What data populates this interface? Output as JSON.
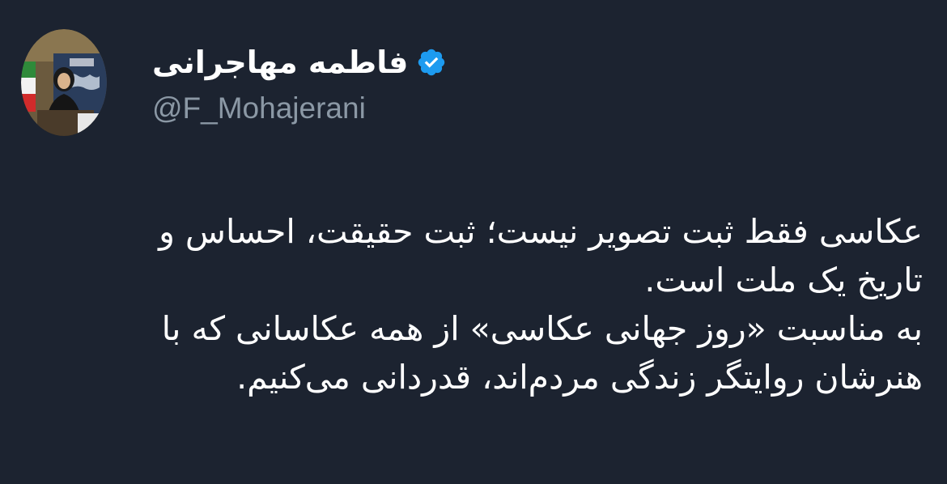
{
  "author": {
    "display_name": "فاطمه مهاجرانی",
    "handle": "@F_Mohajerani",
    "verified": true,
    "avatar_icon": "profile-photo",
    "verified_icon": "verified-badge-icon",
    "verified_color": "#1d9bf0"
  },
  "tweet": {
    "lines": [
      "عکاسی فقط ثبت تصویر نیست؛ ثبت حقیقت، احساس و",
      "تاریخ یک ملت است.",
      "به مناسبت «روز جهانی عکاسی» از همه عکاسانی که با",
      "هنرشان روایتگر زندگی مردم‌اند، قدردانی می‌کنیم."
    ]
  },
  "colors": {
    "background": "#1c2330",
    "text": "#ffffff",
    "secondary_text": "#8b98a5"
  }
}
